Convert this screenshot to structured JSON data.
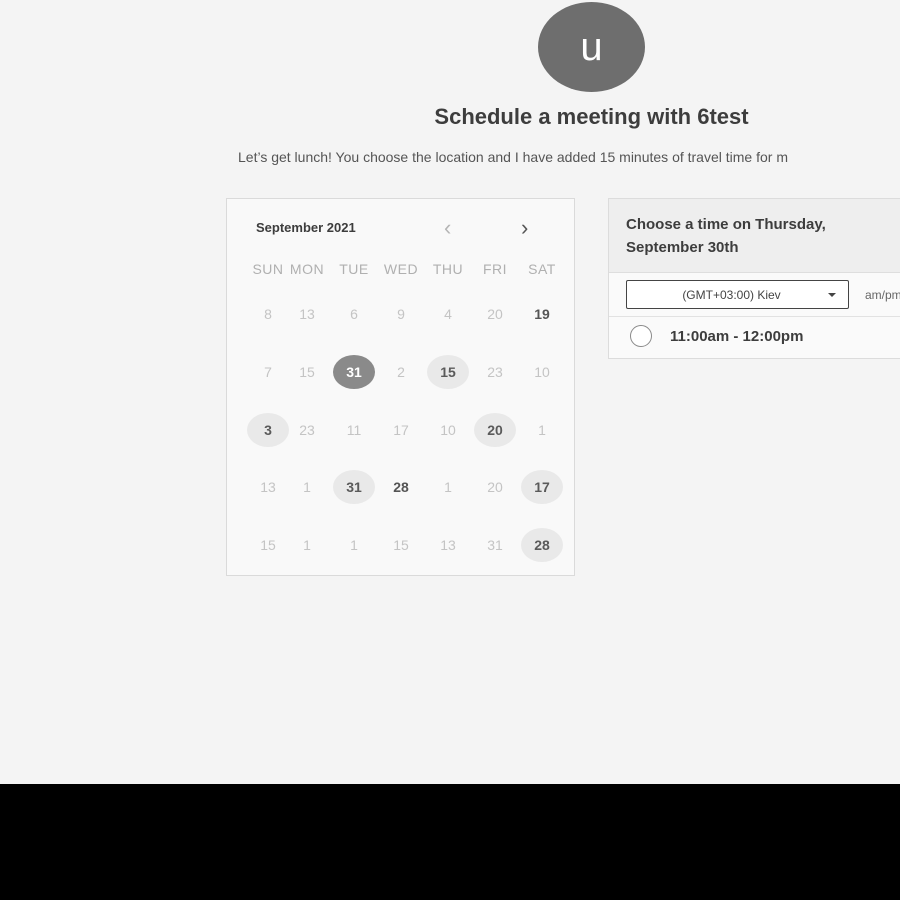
{
  "host": {
    "avatar_letter": "u",
    "title": "Schedule a meeting with 6test",
    "description": "Let’s get lunch! You choose the location and I have added 15 minutes of travel time for m"
  },
  "calendar": {
    "month_label": "September 2021",
    "prev_icon": "chevron-left-icon",
    "next_icon": "chevron-right-icon",
    "prev_glyph": "‹",
    "next_glyph": "›",
    "weekdays": [
      "SUN",
      "MON",
      "TUE",
      "WED",
      "THU",
      "FRI",
      "SAT"
    ],
    "weeks": [
      [
        {
          "d": "8",
          "s": ""
        },
        {
          "d": "13",
          "s": ""
        },
        {
          "d": "6",
          "s": ""
        },
        {
          "d": "9",
          "s": ""
        },
        {
          "d": "4",
          "s": ""
        },
        {
          "d": "20",
          "s": ""
        },
        {
          "d": "19",
          "s": "bold"
        }
      ],
      [
        {
          "d": "7",
          "s": ""
        },
        {
          "d": "15",
          "s": ""
        },
        {
          "d": "31",
          "s": "selected"
        },
        {
          "d": "2",
          "s": ""
        },
        {
          "d": "15",
          "s": "available"
        },
        {
          "d": "23",
          "s": ""
        },
        {
          "d": "10",
          "s": ""
        }
      ],
      [
        {
          "d": "3",
          "s": "available"
        },
        {
          "d": "23",
          "s": ""
        },
        {
          "d": "11",
          "s": ""
        },
        {
          "d": "17",
          "s": ""
        },
        {
          "d": "10",
          "s": ""
        },
        {
          "d": "20",
          "s": "available"
        },
        {
          "d": "1",
          "s": ""
        }
      ],
      [
        {
          "d": "13",
          "s": ""
        },
        {
          "d": "1",
          "s": ""
        },
        {
          "d": "31",
          "s": "available"
        },
        {
          "d": "28",
          "s": "bold"
        },
        {
          "d": "1",
          "s": ""
        },
        {
          "d": "20",
          "s": ""
        },
        {
          "d": "17",
          "s": "available"
        }
      ],
      [
        {
          "d": "15",
          "s": ""
        },
        {
          "d": "1",
          "s": ""
        },
        {
          "d": "1",
          "s": ""
        },
        {
          "d": "15",
          "s": ""
        },
        {
          "d": "13",
          "s": ""
        },
        {
          "d": "31",
          "s": ""
        },
        {
          "d": "28",
          "s": "available"
        }
      ]
    ]
  },
  "time_panel": {
    "heading": "Choose a time on Thursday, September 30th",
    "timezone_value": "(GMT+03:00) Kiev",
    "timezone_icon": "caret-down-icon",
    "format_label": "am/pm",
    "slots": [
      {
        "label": "11:00am - 12:00pm"
      }
    ]
  }
}
